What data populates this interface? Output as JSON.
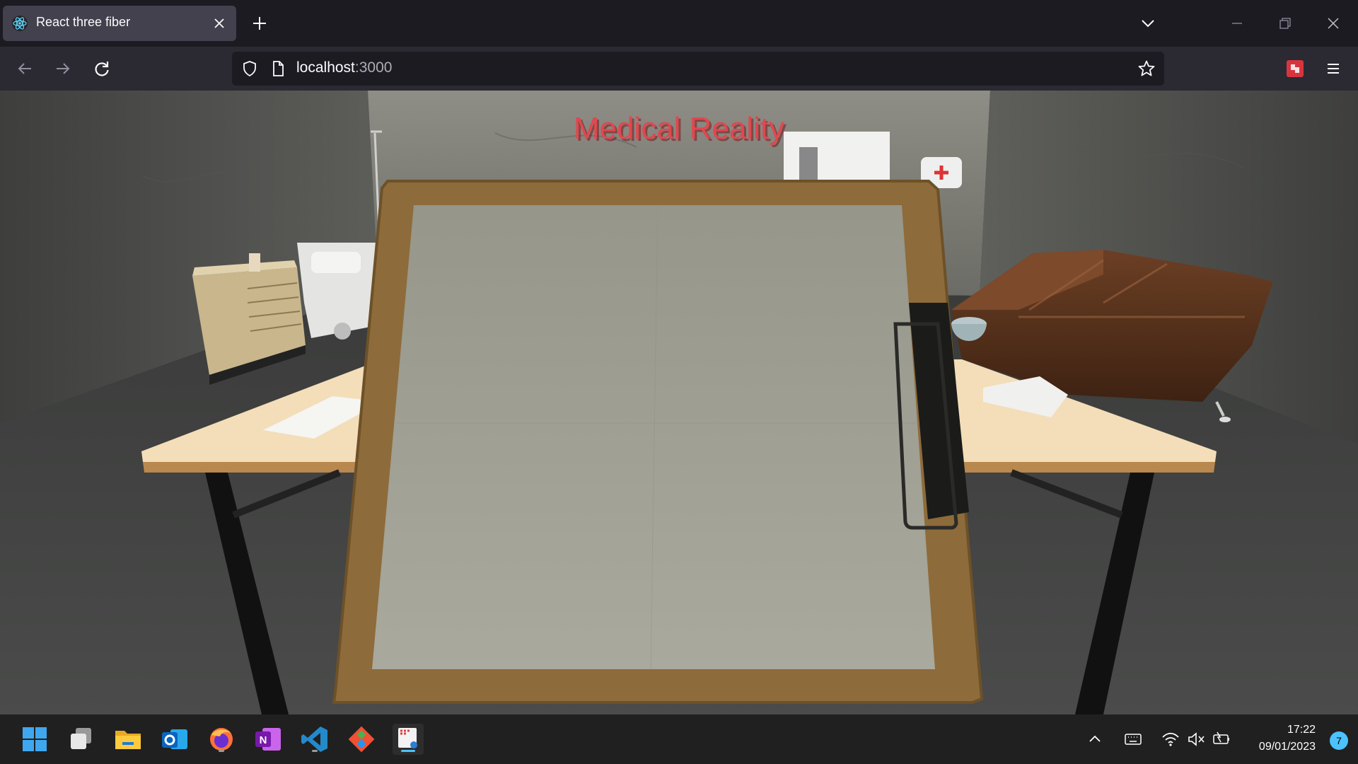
{
  "browser": {
    "tab": {
      "title": "React three fiber",
      "favicon": "react-icon"
    },
    "new_tab_icon": "plus-icon",
    "url": {
      "host": "localhost",
      "port": ":3000"
    },
    "window_controls": [
      "minimize-icon",
      "restore-icon",
      "close-icon"
    ]
  },
  "scene": {
    "sign_text": "Medical Reality",
    "sign_color": "#e0484f",
    "objects": [
      "wall-cabinet",
      "hospital-bed",
      "iv-stand",
      "whiteboard",
      "first-aid-box",
      "leather-sofa",
      "desk",
      "clipboard",
      "paper-sheet",
      "water-bowl"
    ]
  },
  "taskbar": {
    "apps": [
      "start-icon",
      "task-view-icon",
      "file-explorer-icon",
      "outlook-icon",
      "firefox-icon",
      "onenote-icon",
      "vscode-icon",
      "git-icon",
      "snipping-tool-icon"
    ],
    "clock": {
      "time": "17:22",
      "date": "09/01/2023"
    },
    "notification_count": "7"
  }
}
